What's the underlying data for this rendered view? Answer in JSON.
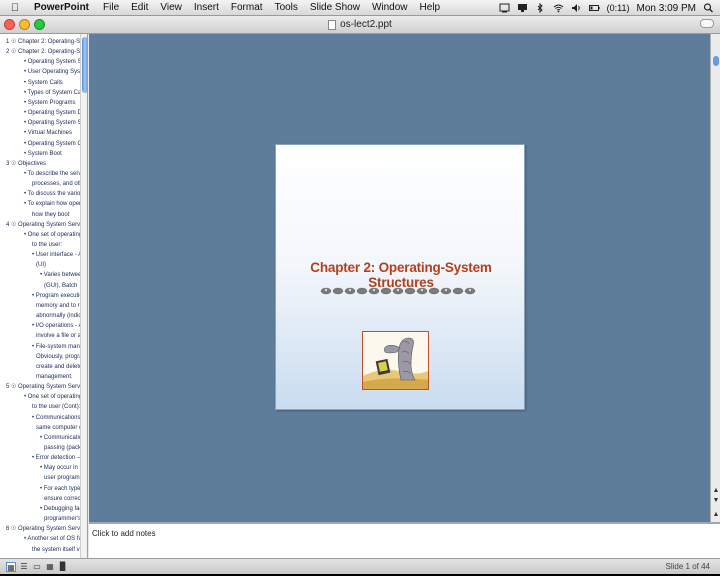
{
  "menubar": {
    "app_name": "PowerPoint",
    "menus": [
      "File",
      "Edit",
      "View",
      "Insert",
      "Format",
      "Tools",
      "Slide Show",
      "Window",
      "Help"
    ],
    "battery": "(0:11)",
    "clock": "Mon 3:09 PM"
  },
  "window": {
    "title": "os-lect2.ppt",
    "lights": [
      "#ff5f57",
      "#febc2e",
      "#28c840"
    ]
  },
  "outline": {
    "rows": [
      "1 ☉  Chapter 2:  Operating-Sy",
      "2 ☉  Chapter 2:  Operating-Sy",
      "• Operating System Se",
      "• User Operating Syste",
      "• System Calls",
      "• Types of System Calls",
      "• System Programs",
      "• Operating System De",
      "• Operating System Str",
      "• Virtual Machines",
      "• Operating System Ge",
      "• System Boot",
      "3 ☉  Objectives",
      "• To describe the servic",
      "processes, and other",
      "• To discuss the various",
      "• To explain how operat",
      "how they boot",
      "4 ☉  Operating System Servic",
      "• One set of operating-s",
      "to the user:",
      "• User interface - Alm",
      "(UI)",
      "• Varies between",
      "(GUI), Batch",
      "• Program execution",
      "memory and to run",
      "abnormally (indicat",
      "• I/O operations - A",
      "involve a file or an",
      "• File-system manipu",
      "Obviously, program",
      "create and delete th",
      "management.",
      "5 ☉  Operating System Servic",
      "• One set of operating-s",
      "to the user (Cont):",
      "• Communications –",
      "same computer or",
      "• Communications",
      "passing (packets",
      "• Error detection – O",
      "• May occur in the",
      "user program",
      "• For each type of",
      "ensure correct a",
      "• Debugging facili",
      "programmer's al",
      "6 ☉  Operating System Servic",
      "• Another set of OS fun",
      "the system itself via r"
    ]
  },
  "slide": {
    "title": "Chapter 2:  Operating-System Structures"
  },
  "notes": {
    "placeholder": "Click to add notes"
  },
  "status": {
    "slide_count": "Slide 1 of 44"
  }
}
